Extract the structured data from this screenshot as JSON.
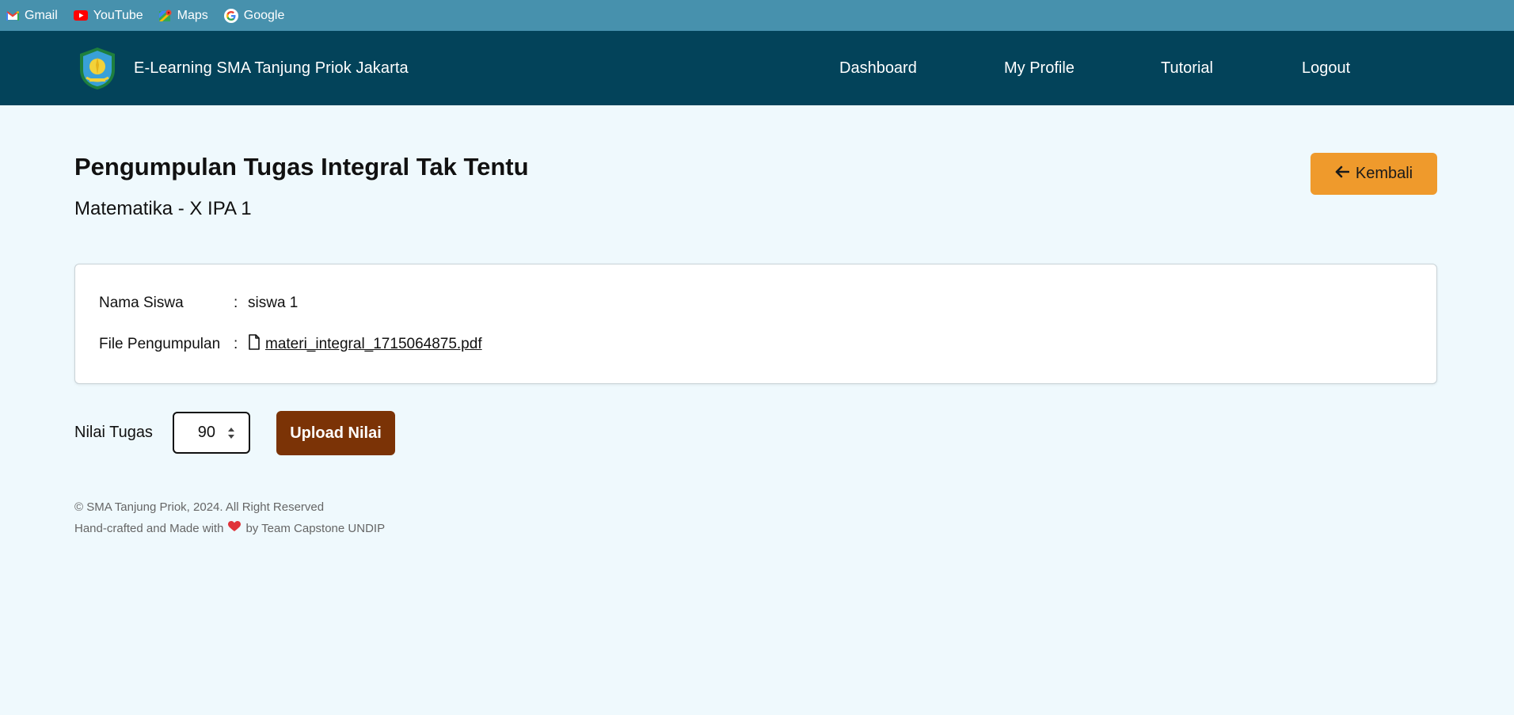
{
  "bookmarks": [
    {
      "label": "Gmail",
      "icon": "gmail-icon"
    },
    {
      "label": "YouTube",
      "icon": "youtube-icon"
    },
    {
      "label": "Maps",
      "icon": "maps-icon"
    },
    {
      "label": "Google",
      "icon": "google-icon"
    }
  ],
  "navbar": {
    "brand": "E-Learning SMA Tanjung Priok Jakarta",
    "links": [
      "Dashboard",
      "My Profile",
      "Tutorial",
      "Logout"
    ]
  },
  "page": {
    "title": "Pengumpulan Tugas Integral Tak Tentu",
    "subtitle": "Matematika - X IPA 1",
    "back_label": "Kembali"
  },
  "submission": {
    "student_label": "Nama Siswa",
    "student_value": "siswa 1",
    "file_label": "File Pengumpulan",
    "file_name": "materi_integral_1715064875.pdf",
    "separator": ":"
  },
  "grade": {
    "label": "Nilai Tugas",
    "value": "90",
    "button": "Upload Nilai"
  },
  "footer": {
    "line1": "© SMA Tanjung Priok, 2024. All Right Reserved",
    "line2_before": "Hand-crafted and Made with",
    "line2_after": "by Team Capstone UNDIP"
  },
  "colors": {
    "bookmarks_bg": "#4791ad",
    "navbar_bg": "#03435a",
    "page_bg": "#eff9fd",
    "back_button": "#ef9a2c",
    "upload_button": "#7b3306",
    "heart": "#e0333a"
  }
}
